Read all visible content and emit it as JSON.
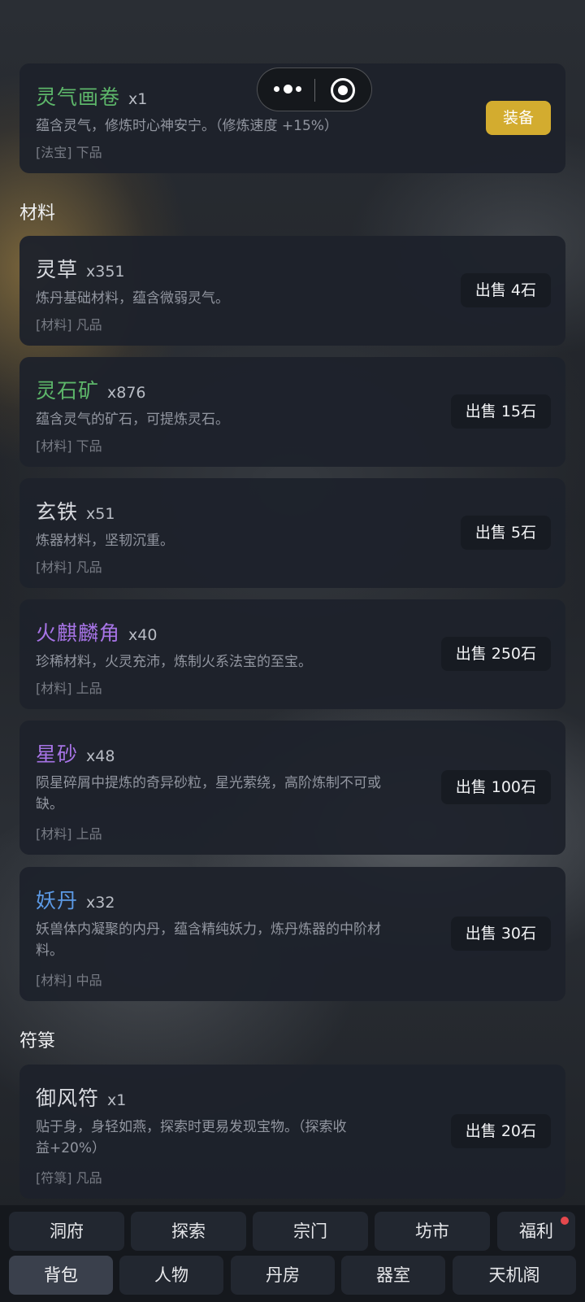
{
  "equipped_item": {
    "name": "灵气画卷",
    "qty": "x1",
    "desc": "蕴含灵气，修炼时心神安宁。（修炼速度 +15%）",
    "tag": "[法宝] 下品",
    "button": "装备"
  },
  "sections": {
    "materials": "材料",
    "talismans": "符箓"
  },
  "materials": [
    {
      "name": "灵草",
      "qty": "x351",
      "desc": "炼丹基础材料，蕴含微弱灵气。",
      "tag": "[材料] 凡品",
      "button": "出售 4石"
    },
    {
      "name": "灵石矿",
      "qty": "x876",
      "desc": "蕴含灵气的矿石，可提炼灵石。",
      "tag": "[材料] 下品",
      "button": "出售 15石"
    },
    {
      "name": "玄铁",
      "qty": "x51",
      "desc": "炼器材料，坚韧沉重。",
      "tag": "[材料] 凡品",
      "button": "出售 5石"
    },
    {
      "name": "火麒麟角",
      "qty": "x40",
      "desc": "珍稀材料，火灵充沛，炼制火系法宝的至宝。",
      "tag": "[材料] 上品",
      "button": "出售 250石"
    },
    {
      "name": "星砂",
      "qty": "x48",
      "desc_line1": "陨星碎屑中提炼的奇异砂粒，星光萦绕，高阶炼制不可或",
      "desc_line2": "缺。",
      "tag": "[材料] 上品",
      "button": "出售 100石"
    },
    {
      "name": "妖丹",
      "qty": "x32",
      "desc_line1": "妖兽体内凝聚的内丹，蕴含精纯妖力，炼丹炼器的中阶材",
      "desc_line2": "料。",
      "tag": "[材料] 中品",
      "button": "出售 30石"
    }
  ],
  "talismans": [
    {
      "name": "御风符",
      "qty": "x1",
      "desc_line1": "贴于身，身轻如燕，探索时更易发现宝物。（探索收",
      "desc_line2": "益+20%）",
      "tag": "[符箓] 凡品",
      "button": "出售 20石"
    }
  ],
  "nav": {
    "row1": [
      "洞府",
      "探索",
      "宗门",
      "坊市",
      "福利"
    ],
    "row2": [
      "背包",
      "人物",
      "丹房",
      "器室",
      "天机阁"
    ]
  },
  "colors": {
    "accent_gold": "#d3ac2f",
    "quality_common": "#d9dbe0",
    "quality_low": "#5db66a",
    "quality_mid": "#5c9ae6",
    "quality_high": "#a774e6",
    "notification_dot": "#e5484d"
  },
  "icons": {
    "capsule_more": "more-dots-icon",
    "capsule_close": "target-circle-icon"
  }
}
